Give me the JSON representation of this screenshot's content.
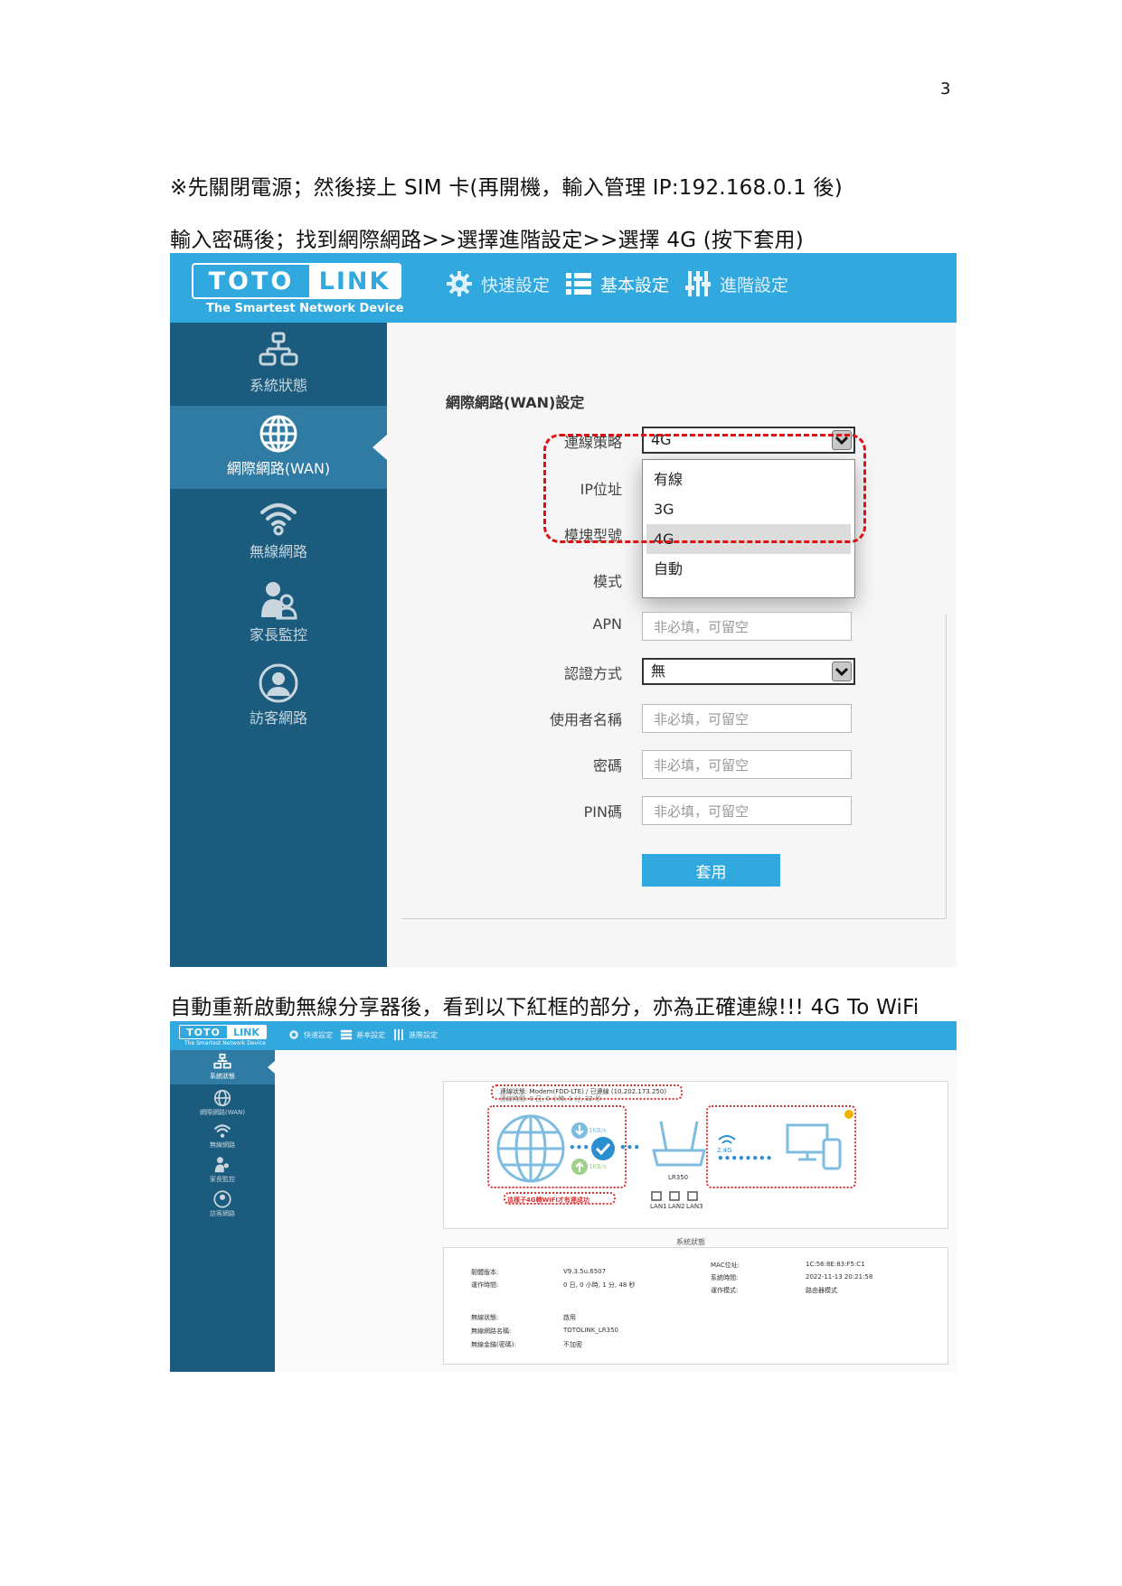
{
  "page_number": "3",
  "instructions": {
    "line1": "※先關閉電源；然後接上 SIM 卡(再開機，輸入管理 IP:192.168.0.1 後)",
    "line2": "輸入密碼後；找到網際網路>>選擇進階設定>>選擇 4G (按下套用)",
    "line3": "自動重新啟動無線分享器後，看到以下紅框的部分，亦為正確連線!!! 4G To WiFi"
  },
  "colors": {
    "header_blue": "#31a8de",
    "sidebar_dark": "#1b5b7e",
    "sidebar_active": "#2f7ba3",
    "highlight_red": "#dd1111"
  },
  "screenshot1": {
    "logo_left": "TOTO",
    "logo_right": "LINK",
    "tagline": "The Smartest Network Device",
    "topnav": [
      {
        "label": "快速設定",
        "icon": "gear-icon"
      },
      {
        "label": "基本設定",
        "icon": "list-icon"
      },
      {
        "label": "進階設定",
        "icon": "sliders-icon"
      }
    ],
    "sidebar": [
      {
        "label": "系統狀態",
        "icon": "network-topology-icon",
        "active": false
      },
      {
        "label": "網際網路(WAN)",
        "icon": "globe-icon",
        "active": true
      },
      {
        "label": "無線網路",
        "icon": "wifi-icon",
        "active": false
      },
      {
        "label": "家長監控",
        "icon": "parent-child-icon",
        "active": false
      },
      {
        "label": "訪客網路",
        "icon": "guest-user-icon",
        "active": false
      }
    ],
    "section_title": "網際網路(WAN)設定",
    "form": {
      "strategy_label": "連線策略",
      "strategy_value": "4G",
      "strategy_options": [
        "有線",
        "3G",
        "4G",
        "自動"
      ],
      "strategy_highlighted": "4G",
      "ip_label": "IP位址",
      "module_label": "模塊型號",
      "mode_label": "模式",
      "apn_label": "APN",
      "apn_placeholder": "非必填，可留空",
      "auth_label": "認證方式",
      "auth_value": "無",
      "username_label": "使用者名稱",
      "username_placeholder": "非必填，可留空",
      "password_label": "密碼",
      "password_placeholder": "非必填，可留空",
      "pin_label": "PIN碼",
      "pin_placeholder": "非必填，可留空",
      "apply_label": "套用"
    }
  },
  "screenshot2": {
    "logo_left": "TOTO",
    "logo_right": "LINK",
    "tagline": "The Smartest Network Device",
    "topnav": [
      "快速設定",
      "基本設定",
      "進階設定"
    ],
    "sidebar": [
      "系統狀態",
      "網際網路(WAN)",
      "無線網路",
      "家長監控",
      "訪客網路"
    ],
    "status_line1": "連線狀態: Modem(FDD-LTE) / 已連線 (10.202.173.250)",
    "status_line2": "連線時間: 0 日, 0 小時, 1 分, 32 秒",
    "speed_down": "1KB/s",
    "speed_up": "1KB/s",
    "router_model": "LR350",
    "caption_red": "這樣子4G轉WiFi才有連成功",
    "band": "2.4G",
    "lan_ports": [
      "LAN1",
      "LAN2",
      "LAN3"
    ],
    "system_status_title": "系統狀態",
    "info": {
      "firmware_label": "韌體版本:",
      "firmware_value": "V9.3.5u.6507",
      "uptime_label": "運作時間:",
      "uptime_value": "0 日, 0 小時, 1 分, 48 秒",
      "mac_label": "MAC位址:",
      "mac_value": "1C:56:8E:83:F5:C1",
      "systime_label": "系統時間:",
      "systime_value": "2022-11-13 20:21:58",
      "opmode_label": "運作模式:",
      "opmode_value": "路由器模式",
      "wifi_status_label": "無線狀態:",
      "wifi_status_value": "啟用",
      "ssid_label": "無線網路名稱:",
      "ssid_value": "TOTOLINK_LR350",
      "security_label": "無線金鑰(密碼):",
      "security_value": "不加密"
    }
  }
}
